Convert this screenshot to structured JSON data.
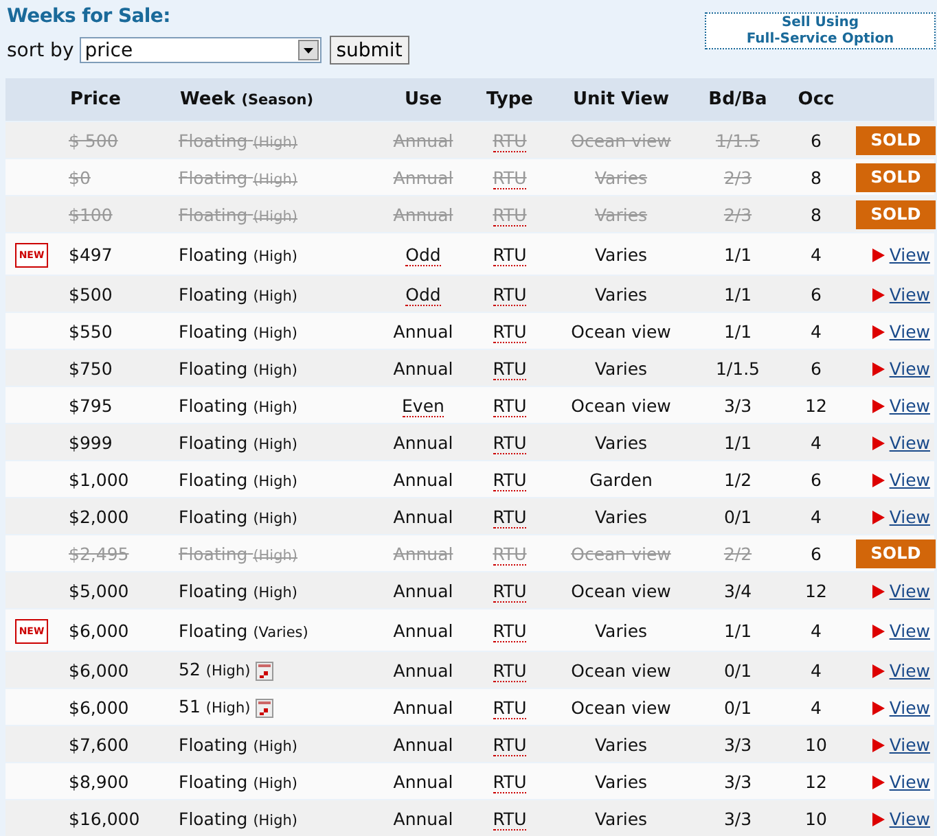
{
  "title": "Weeks for Sale:",
  "sort": {
    "label": "sort by",
    "value": "price",
    "button": "submit"
  },
  "sell_button": [
    "Sell Using",
    "Full-Service Option"
  ],
  "columns": [
    "Price",
    "Week",
    "(Season)",
    "Use",
    "Type",
    "Unit View",
    "Bd/Ba",
    "Occ"
  ],
  "rows": [
    {
      "badge": null,
      "price": "$  500",
      "week": "Floating",
      "season": "(High)",
      "calendar": false,
      "use": "Annual",
      "use_note": false,
      "type": "RTU",
      "view": "Ocean view",
      "bdba": "1/1.5",
      "occ": "6",
      "sold": true,
      "action": "SOLD"
    },
    {
      "badge": null,
      "price": "$0",
      "week": "Floating",
      "season": "(High)",
      "calendar": false,
      "use": "Annual",
      "use_note": false,
      "type": "RTU",
      "view": "Varies",
      "bdba": "2/3",
      "occ": "8",
      "sold": true,
      "action": "SOLD"
    },
    {
      "badge": null,
      "price": "$100",
      "week": "Floating",
      "season": "(High)",
      "calendar": false,
      "use": "Annual",
      "use_note": false,
      "type": "RTU",
      "view": "Varies",
      "bdba": "2/3",
      "occ": "8",
      "sold": true,
      "action": "SOLD"
    },
    {
      "badge": "NEW",
      "price": "$497",
      "week": "Floating",
      "season": "(High)",
      "calendar": false,
      "use": "Odd",
      "use_note": true,
      "type": "RTU",
      "view": "Varies",
      "bdba": "1/1",
      "occ": "4",
      "sold": false,
      "action": "View"
    },
    {
      "badge": null,
      "price": "$500",
      "week": "Floating",
      "season": "(High)",
      "calendar": false,
      "use": "Odd",
      "use_note": true,
      "type": "RTU",
      "view": "Varies",
      "bdba": "1/1",
      "occ": "6",
      "sold": false,
      "action": "View"
    },
    {
      "badge": null,
      "price": "$550",
      "week": "Floating",
      "season": "(High)",
      "calendar": false,
      "use": "Annual",
      "use_note": false,
      "type": "RTU",
      "view": "Ocean view",
      "bdba": "1/1",
      "occ": "4",
      "sold": false,
      "action": "View"
    },
    {
      "badge": null,
      "price": "$750",
      "week": "Floating",
      "season": "(High)",
      "calendar": false,
      "use": "Annual",
      "use_note": false,
      "type": "RTU",
      "view": "Varies",
      "bdba": "1/1.5",
      "occ": "6",
      "sold": false,
      "action": "View"
    },
    {
      "badge": null,
      "price": "$795",
      "week": "Floating",
      "season": "(High)",
      "calendar": false,
      "use": "Even",
      "use_note": true,
      "type": "RTU",
      "view": "Ocean view",
      "bdba": "3/3",
      "occ": "12",
      "sold": false,
      "action": "View"
    },
    {
      "badge": null,
      "price": "$999",
      "week": "Floating",
      "season": "(High)",
      "calendar": false,
      "use": "Annual",
      "use_note": false,
      "type": "RTU",
      "view": "Varies",
      "bdba": "1/1",
      "occ": "4",
      "sold": false,
      "action": "View"
    },
    {
      "badge": null,
      "price": "$1,000",
      "week": "Floating",
      "season": "(High)",
      "calendar": false,
      "use": "Annual",
      "use_note": false,
      "type": "RTU",
      "view": "Garden",
      "bdba": "1/2",
      "occ": "6",
      "sold": false,
      "action": "View"
    },
    {
      "badge": null,
      "price": "$2,000",
      "week": "Floating",
      "season": "(High)",
      "calendar": false,
      "use": "Annual",
      "use_note": false,
      "type": "RTU",
      "view": "Varies",
      "bdba": "0/1",
      "occ": "4",
      "sold": false,
      "action": "View"
    },
    {
      "badge": null,
      "price": "$2,495",
      "week": "Floating",
      "season": "(High)",
      "calendar": false,
      "use": "Annual",
      "use_note": false,
      "type": "RTU",
      "view": "Ocean view",
      "bdba": "2/2",
      "occ": "6",
      "sold": true,
      "action": "SOLD"
    },
    {
      "badge": null,
      "price": "$5,000",
      "week": "Floating",
      "season": "(High)",
      "calendar": false,
      "use": "Annual",
      "use_note": false,
      "type": "RTU",
      "view": "Ocean view",
      "bdba": "3/4",
      "occ": "12",
      "sold": false,
      "action": "View"
    },
    {
      "badge": "NEW",
      "price": "$6,000",
      "week": "Floating",
      "season": "(Varies)",
      "calendar": false,
      "use": "Annual",
      "use_note": false,
      "type": "RTU",
      "view": "Varies",
      "bdba": "1/1",
      "occ": "4",
      "sold": false,
      "action": "View"
    },
    {
      "badge": null,
      "price": "$6,000",
      "week": "52",
      "season": "(High)",
      "calendar": true,
      "use": "Annual",
      "use_note": false,
      "type": "RTU",
      "view": "Ocean view",
      "bdba": "0/1",
      "occ": "4",
      "sold": false,
      "action": "View"
    },
    {
      "badge": null,
      "price": "$6,000",
      "week": "51",
      "season": "(High)",
      "calendar": true,
      "use": "Annual",
      "use_note": false,
      "type": "RTU",
      "view": "Ocean view",
      "bdba": "0/1",
      "occ": "4",
      "sold": false,
      "action": "View"
    },
    {
      "badge": null,
      "price": "$7,600",
      "week": "Floating",
      "season": "(High)",
      "calendar": false,
      "use": "Annual",
      "use_note": false,
      "type": "RTU",
      "view": "Varies",
      "bdba": "3/3",
      "occ": "10",
      "sold": false,
      "action": "View"
    },
    {
      "badge": null,
      "price": "$8,900",
      "week": "Floating",
      "season": "(High)",
      "calendar": false,
      "use": "Annual",
      "use_note": false,
      "type": "RTU",
      "view": "Varies",
      "bdba": "3/3",
      "occ": "12",
      "sold": false,
      "action": "View"
    },
    {
      "badge": null,
      "price": "$16,000",
      "week": "Floating",
      "season": "(High)",
      "calendar": false,
      "use": "Annual",
      "use_note": false,
      "type": "RTU",
      "view": "Varies",
      "bdba": "3/3",
      "occ": "10",
      "sold": false,
      "action": "View"
    }
  ]
}
